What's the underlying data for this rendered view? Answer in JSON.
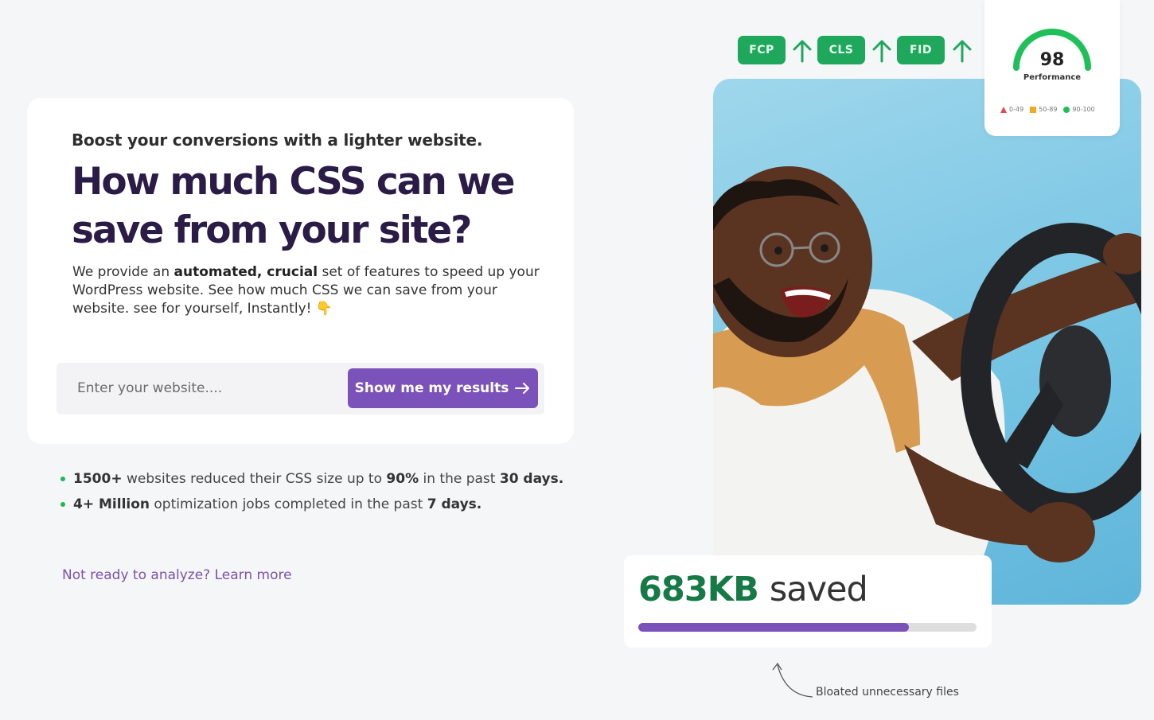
{
  "hero": {
    "kicker": "Boost your conversions with a lighter website.",
    "headline": "How much CSS can we save from your site?",
    "desc_1": "We provide an ",
    "desc_bold": "automated, crucial",
    "desc_2": " set of features to speed up your WordPress website. See how much CSS we can save from your website. see for yourself, Instantly! 👇"
  },
  "form": {
    "placeholder": "Enter your website....",
    "button_label": "Show me my results"
  },
  "stats": [
    {
      "a": "1500+",
      "b": " websites reduced their CSS size up to ",
      "c": "90%",
      "d": " in the past ",
      "e": "30 days."
    },
    {
      "a": "4+ Million",
      "b": " optimization jobs completed in the past ",
      "c": "7 days."
    }
  ],
  "learn_more": "Not ready to analyze? Learn more",
  "metrics": [
    "FCP",
    "CLS",
    "FID"
  ],
  "performance": {
    "score": "98",
    "label": "Performance",
    "legend": [
      "0-49",
      "50-89",
      "90-100"
    ],
    "colors": {
      "poor": "#e5484d",
      "average": "#f5a623",
      "good": "#1fbf5a"
    }
  },
  "saved": {
    "amount": "683KB",
    "word": "saved",
    "progress": 0.8
  },
  "caption": "Bloated unnecessary files",
  "colors": {
    "accent": "#7b52b9",
    "headline": "#2a1b47",
    "green": "#157a45",
    "metric": "#1fa85c"
  }
}
